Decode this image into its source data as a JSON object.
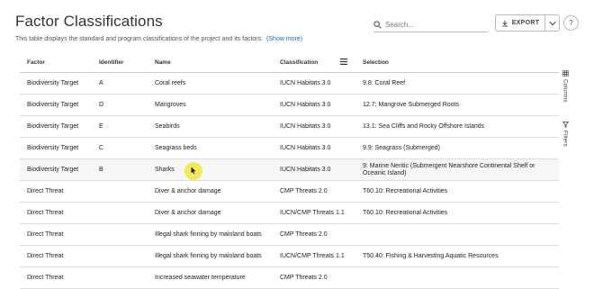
{
  "header": {
    "title": "Factor Classifications",
    "subtitle": "This table displays the standard and program classifications of the project and its factors.",
    "show_more": "(Show more)"
  },
  "search": {
    "placeholder": "Search..."
  },
  "export": {
    "label": "EXPORT"
  },
  "help": {
    "label": "?"
  },
  "table": {
    "columns": [
      "Factor",
      "Identifier",
      "Name",
      "Classification",
      "Selection"
    ],
    "rows": [
      [
        "Biodiversity Target",
        "A",
        "Coral reefs",
        "IUCN Habitats 3.0",
        "9.8: Coral Reef"
      ],
      [
        "Biodiversity Target",
        "D",
        "Mangroves",
        "IUCN Habitats 3.0",
        "12.7: Mangrove Submerged Roots"
      ],
      [
        "Biodiversity Target",
        "E",
        "Seabirds",
        "IUCN Habitats 3.0",
        "13.1: Sea Cliffs and Rocky Offshore Islands"
      ],
      [
        "Biodiversity Target",
        "C",
        "Seagrass beds",
        "IUCN Habitats 3.0",
        "9.9: Seagrass (Submerged)"
      ],
      [
        "Biodiversity Target",
        "B",
        "Sharks",
        "IUCN Habitats 3.0",
        "9: Marine Neritic (Submergent Nearshore Continental Shelf or Oceanic Island)"
      ],
      [
        "Direct Threat",
        "",
        "Diver & anchor damage",
        "CMP Threats 2.0",
        "T60.10: Recreational Activities"
      ],
      [
        "Direct Threat",
        "",
        "Diver & anchor damage",
        "IUCN/CMP Threats 1.1",
        "T60.10: Recreational Activities"
      ],
      [
        "Direct Threat",
        "",
        "Illegal shark finning by mainland boats",
        "CMP Threats 2.0",
        ""
      ],
      [
        "Direct Threat",
        "",
        "Illegal shark finning by mainland boats",
        "IUCN/CMP Threats 1.1",
        "T50.40: Fishing & Harvesting Aquatic Resources"
      ],
      [
        "Direct Threat",
        "",
        "Increased seawater temperature",
        "CMP Threats 2.0",
        ""
      ]
    ]
  },
  "side_panel": {
    "columns_label": "Columns",
    "filters_label": "Filters"
  },
  "icons": {
    "search": "search-icon",
    "export": "download-icon",
    "caret": "chevron-down-icon",
    "menu": "menu-icon",
    "columns": "grid-icon",
    "filters": "filter-icon",
    "cursor": "cursor-icon"
  }
}
